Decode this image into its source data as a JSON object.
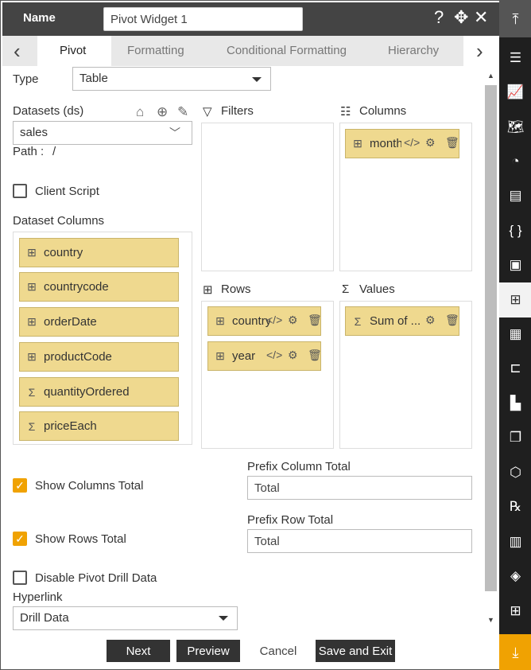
{
  "header": {
    "name_label": "Name",
    "name_value": "Pivot Widget 1",
    "help_icon": "?",
    "move_icon": "✥",
    "close_icon": "✕"
  },
  "tabs": [
    {
      "label": "Pivot"
    },
    {
      "label": "Formatting"
    },
    {
      "label": "Conditional Formatting"
    },
    {
      "label": "Hierarchy"
    }
  ],
  "type": {
    "label": "Type",
    "value": "Table"
  },
  "datasets": {
    "label": "Datasets (ds)",
    "value": "sales",
    "path_label": "Path :",
    "path_value": "/"
  },
  "client_script": {
    "label": "Client Script",
    "checked": false
  },
  "dataset_columns": {
    "label": "Dataset Columns",
    "items": [
      {
        "icon": "table-icon",
        "label": "country"
      },
      {
        "icon": "table-icon",
        "label": "countrycode"
      },
      {
        "icon": "table-icon",
        "label": "orderDate"
      },
      {
        "icon": "table-icon",
        "label": "productCode"
      },
      {
        "icon": "sigma-icon",
        "label": "quantityOrdered"
      },
      {
        "icon": "sigma-icon",
        "label": "priceEach"
      }
    ]
  },
  "filters": {
    "label": "Filters"
  },
  "columns": {
    "label": "Columns",
    "items": [
      {
        "label": "month"
      }
    ]
  },
  "rows": {
    "label": "Rows",
    "items": [
      {
        "label": "country"
      },
      {
        "label": "year"
      }
    ]
  },
  "values": {
    "label": "Values",
    "items": [
      {
        "label": "Sum of ..."
      }
    ]
  },
  "totals": {
    "show_columns_total": {
      "label": "Show Columns Total",
      "checked": true
    },
    "prefix_column_total": {
      "label": "Prefix Column Total",
      "value": "Total"
    },
    "show_rows_total": {
      "label": "Show Rows Total",
      "checked": true
    },
    "prefix_row_total": {
      "label": "Prefix Row Total",
      "value": "Total"
    }
  },
  "disable_drill": {
    "label": "Disable Pivot Drill Data",
    "checked": false
  },
  "hyperlink": {
    "label": "Hyperlink",
    "value": "Drill Data"
  },
  "buttons": {
    "next": "Next",
    "preview": "Preview",
    "cancel": "Cancel",
    "save_exit": "Save and Exit"
  },
  "colors": {
    "accent": "#f0a202",
    "chip_fill": "#efd98f",
    "header_bg": "#444444",
    "toolbar_bg": "#1f1f1f"
  },
  "toolbar_icons": [
    "collapse-top-icon",
    "list-icon",
    "line-chart-icon",
    "map-icon",
    "pie-doc-icon",
    "document-icon",
    "code-braces-icon",
    "image-icon",
    "pivot-table-icon",
    "report-icon",
    "tree-icon",
    "bar-chart-icon",
    "copy-icon",
    "cubes-icon",
    "rx-icon",
    "file-list-icon",
    "layers-icon",
    "add-widget-icon",
    "download-icon"
  ]
}
